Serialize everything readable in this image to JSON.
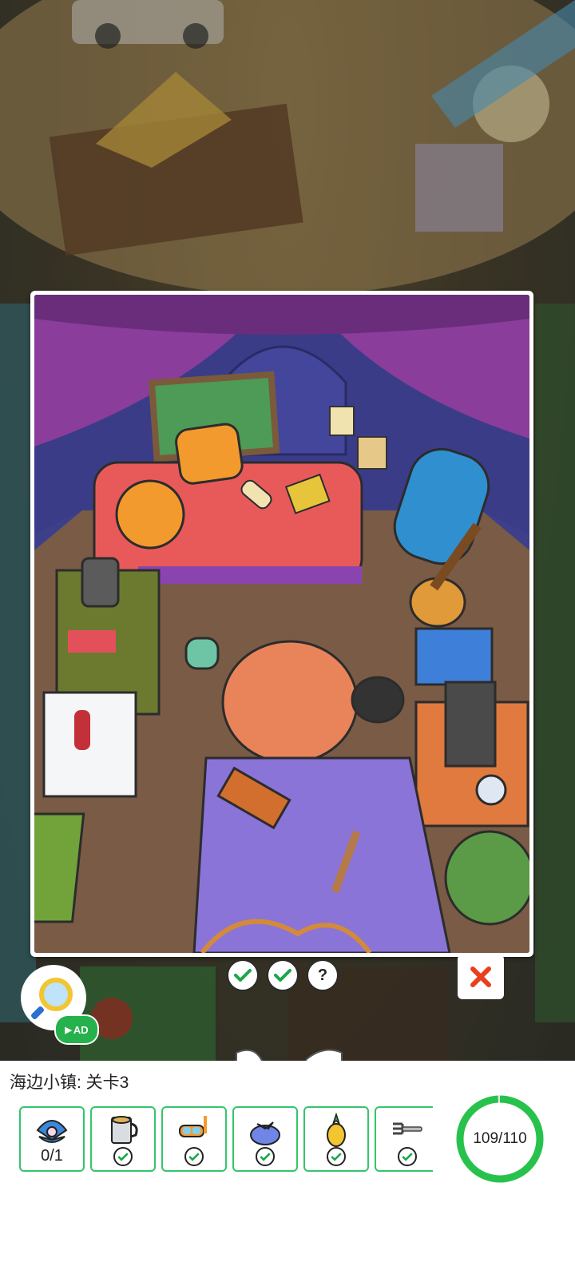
{
  "level": {
    "title": "海边小镇: 关卡3"
  },
  "found_markers": [
    {
      "state": "found",
      "glyph": "✔"
    },
    {
      "state": "found",
      "glyph": "✔"
    },
    {
      "state": "unknown",
      "glyph": "?"
    }
  ],
  "close_glyph": "✕",
  "hint": {
    "ad_label": "AD"
  },
  "items": [
    {
      "name": "pearl-shell",
      "icon": "shell-icon",
      "count": "0/1",
      "found": false
    },
    {
      "name": "mug",
      "icon": "mug-icon",
      "found": true
    },
    {
      "name": "snorkel-mask",
      "icon": "snorkel-icon",
      "found": true
    },
    {
      "name": "cloth-bundle",
      "icon": "bundle-icon",
      "found": true
    },
    {
      "name": "pineapple",
      "icon": "pineapple-icon",
      "found": true
    },
    {
      "name": "fork",
      "icon": "fork-icon",
      "found": true
    }
  ],
  "progress": {
    "label": "109/110",
    "found": 109,
    "total": 110,
    "color": "#27c24c"
  },
  "colors": {
    "accent_green": "#35c56b",
    "close_red": "#e8401f",
    "tent_purple": "#6a3f96"
  }
}
